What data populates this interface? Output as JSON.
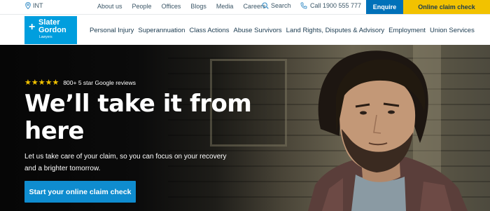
{
  "utility": {
    "location": "INT",
    "links": [
      "About us",
      "People",
      "Offices",
      "Blogs",
      "Media",
      "Careers"
    ],
    "search_label": "Search",
    "call_label": "Call 1900 555 777",
    "enquire_label": "Enquire",
    "claim_label": "Online claim check"
  },
  "logo": {
    "line1": "Slater",
    "line2": "Gordon",
    "line3": "Lawyers"
  },
  "nav": {
    "items": [
      "Personal Injury",
      "Superannuation",
      "Class Actions",
      "Abuse Survivors",
      "Land Rights, Disputes & Advisory",
      "Employment",
      "Union Services"
    ]
  },
  "hero": {
    "stars": "★★★★★",
    "rating_text": "800+ 5 star Google reviews",
    "headline": "We’ll take it from here",
    "subtext": "Let us take care of your claim, so you can focus on your recovery and a brighter tomorrow.",
    "cta_label": "Start your online claim check"
  },
  "colors": {
    "brand_blue": "#009ede",
    "enquire_blue": "#0071b9",
    "cta_blue": "#0f8ccf",
    "claim_yellow": "#f2c200",
    "star_yellow": "#f2c200",
    "nav_text": "#1a3a4f"
  }
}
